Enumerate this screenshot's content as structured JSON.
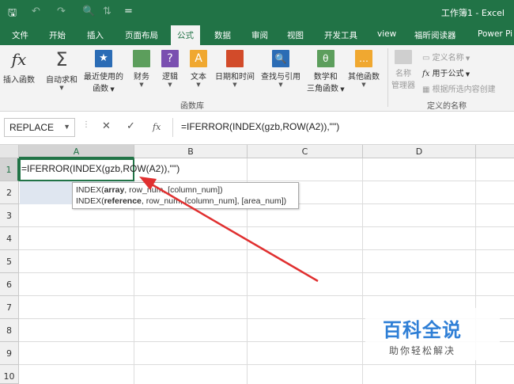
{
  "window": {
    "title": "工作簿1 - Excel"
  },
  "quick_access": {
    "save": "🖫",
    "undo": "↶",
    "redo": "↷",
    "preview": "🔍",
    "sort": "⇅",
    "more": "="
  },
  "tabs": [
    "文件",
    "开始",
    "插入",
    "页面布局",
    "公式",
    "数据",
    "审阅",
    "视图",
    "开发工具",
    "view",
    "福昕阅读器",
    "Power Pi"
  ],
  "ribbon": {
    "insert_function": "插入函数",
    "autosum": "自动求和",
    "recent": [
      "最近使用的",
      "函数"
    ],
    "finance": "财务",
    "logic": "逻辑",
    "text": "文本",
    "datetime": "日期和时间",
    "lookup": "查找与引用",
    "math": [
      "数学和",
      "三角函数"
    ],
    "other": "其他函数",
    "group_library": "函数库",
    "name_manager": [
      "名称",
      "管理器"
    ],
    "define_name": "定义名称",
    "use_in_formula": "用于公式",
    "create_from_selection": "根据所选内容创建",
    "group_names": "定义的名称"
  },
  "formula_bar": {
    "name_box": "REPLACE",
    "cancel": "✕",
    "enter": "✓",
    "fx": "fx",
    "formula": "=IFERROR(INDEX(gzb,ROW(A2)),\"\")"
  },
  "grid": {
    "columns": [
      "A",
      "B",
      "C",
      "D"
    ],
    "rows": [
      "1",
      "2",
      "3",
      "4",
      "5",
      "6",
      "7",
      "8",
      "9",
      "10"
    ],
    "a1_text": "=IFERROR(INDEX(gzb,ROW(A2)),\"\")"
  },
  "tooltip": {
    "line1_pre": "INDEX(",
    "line1_bold": "array",
    "line1_post": ", row_num, [column_num])",
    "line2_pre": "INDEX(",
    "line2_bold": "reference",
    "line2_post": ", row_num, [column_num], [area_num])"
  },
  "watermark": {
    "title": "百科全说",
    "subtitle": "助你轻松解决"
  },
  "colors": {
    "excel_green": "#217346",
    "arrow_red": "#e03030",
    "watermark_blue": "#2f7fd6"
  }
}
